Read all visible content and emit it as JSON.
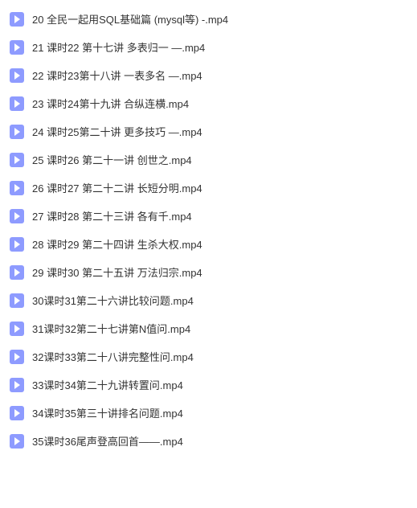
{
  "files": [
    {
      "name": "20 全民一起用SQL基础篇 (mysql等) -.mp4"
    },
    {
      "name": "21 课时22 第十七讲 多表归一 —.mp4"
    },
    {
      "name": "22 课时23第十八讲 一表多名 —.mp4"
    },
    {
      "name": "23 课时24第十九讲 合纵连横.mp4"
    },
    {
      "name": "24 课时25第二十讲 更多技巧 —.mp4"
    },
    {
      "name": "25 课时26 第二十一讲 创世之.mp4"
    },
    {
      "name": "26 课时27 第二十二讲 长短分明.mp4"
    },
    {
      "name": "27 课时28 第二十三讲 各有千.mp4"
    },
    {
      "name": "28 课时29 第二十四讲 生杀大权.mp4"
    },
    {
      "name": "29 课时30 第二十五讲 万法归宗.mp4"
    },
    {
      "name": "30课时31第二十六讲比较问题.mp4"
    },
    {
      "name": "31课时32第二十七讲第N值问.mp4"
    },
    {
      "name": "32课时33第二十八讲完整性问.mp4"
    },
    {
      "name": "33课时34第二十九讲转置问.mp4"
    },
    {
      "name": "34课时35第三十讲排名问题.mp4"
    },
    {
      "name": "35课时36尾声登高回首——.mp4"
    }
  ]
}
